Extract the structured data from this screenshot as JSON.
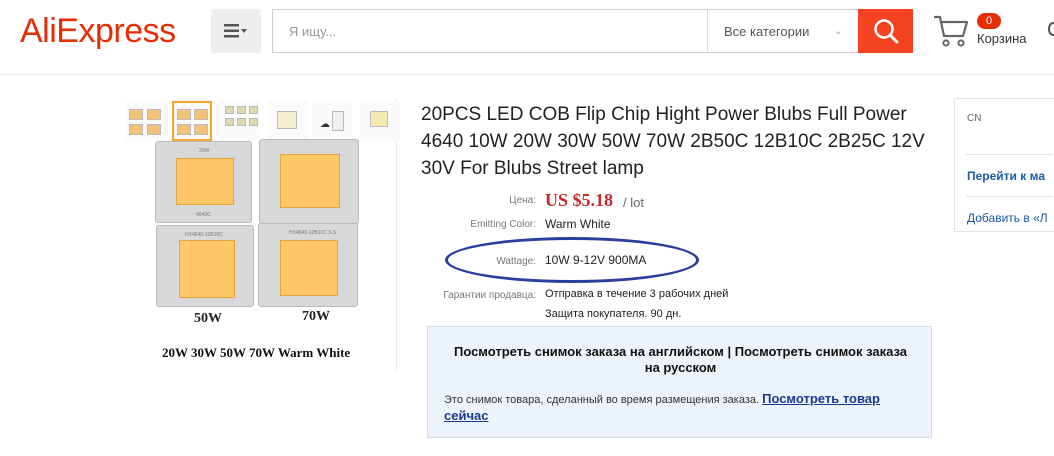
{
  "header": {
    "logo": "AliExpress",
    "search_placeholder": "Я ищу...",
    "category": "Все категории",
    "cart_count": "0",
    "cart_label": "Корзина"
  },
  "product": {
    "title": "20PCS LED COB Flip Chip Hight Power Blubs Full Power 4640 10W 20W 30W 50W 70W 2B50C 12B10C 2B25C 12V 30V For Blubs Street lamp",
    "image_labels": {
      "left": "50W",
      "right": "70W",
      "caption": "20W 30W 50W 70W Warm White",
      "chip_top": "20W",
      "chip_model": "4640C",
      "chip_code1": "HX4640-12B10C",
      "chip_code2": "HX4640-12B10C S.S"
    },
    "price_label": "Цена:",
    "price": "US $5.18",
    "price_unit": "/ lot",
    "color_label": "Emitting Color:",
    "color_value": "Warm White",
    "wattage_label": "Wattage:",
    "wattage_value": "10W 9-12V 900MA",
    "guarantee_label": "Гарантии продавца:",
    "guarantee_line1": "Отправка в течение 3 рабочих дней",
    "guarantee_line2": "Защита покупателя. 90 дн."
  },
  "snapshot": {
    "heading": "Посмотреть снимок заказа на английском | Посмотреть снимок заказа на русском",
    "text": "Это снимок товара, сделанный во время размещения заказа.",
    "link": "Посмотреть товар сейчас"
  },
  "side": {
    "country": "CN",
    "link1": "Перейти к ма",
    "link2": "Добавить в «Л"
  },
  "colors": {
    "brand": "#e62e04",
    "search_button": "#f44321",
    "price": "#c62828",
    "annotation_ellipse": "#2a3ea0",
    "link": "#1a3c8f"
  }
}
